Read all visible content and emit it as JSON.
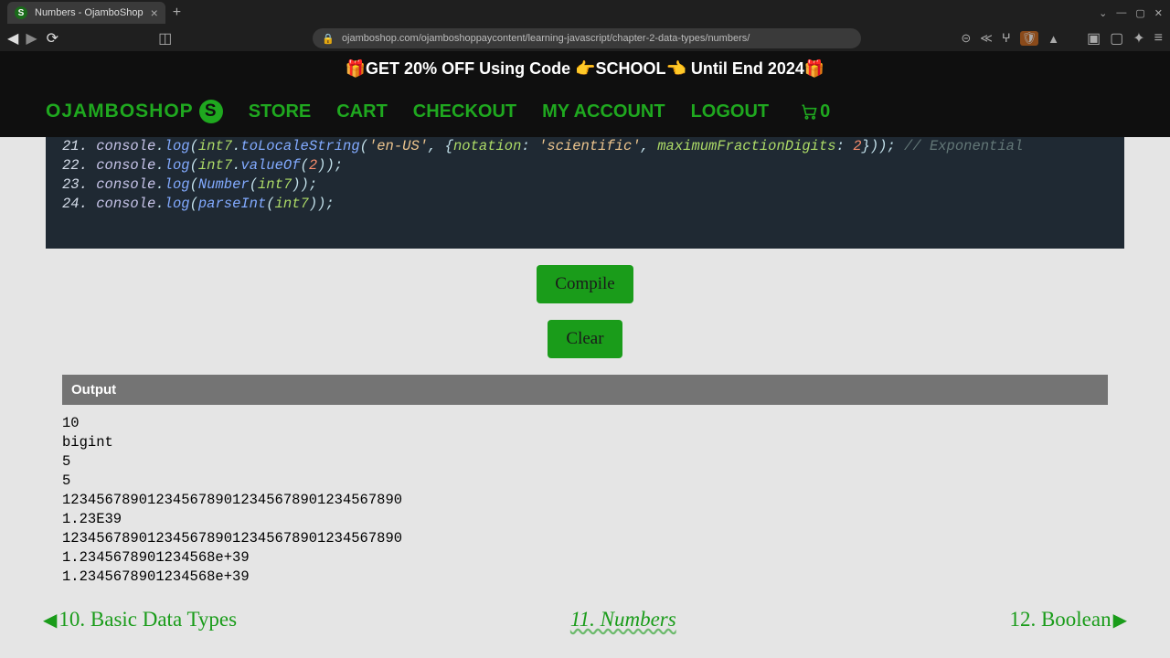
{
  "browser": {
    "tab_title": "Numbers - OjamboShop",
    "tab_favicon_letter": "S",
    "url": "ojamboshop.com/ojamboshoppaycontent/learning-javascript/chapter-2-data-types/numbers/"
  },
  "promo": "🎁GET 20% OFF Using Code 👉SCHOOL👈 Until End 2024🎁",
  "brand": {
    "name": "OJAMBOSHOP",
    "icon_letter": "S"
  },
  "nav": {
    "store": "STORE",
    "cart": "CART",
    "checkout": "CHECKOUT",
    "account": "MY ACCOUNT",
    "logout": "LOGOUT",
    "cart_count": "0"
  },
  "code_lines": [
    {
      "n": "21.",
      "segments": [
        {
          "c": "kw1",
          "t": "console"
        },
        {
          "c": "pn",
          "t": "."
        },
        {
          "c": "fn",
          "t": "log"
        },
        {
          "c": "pn",
          "t": "("
        },
        {
          "c": "var",
          "t": "int7"
        },
        {
          "c": "pn",
          "t": "."
        },
        {
          "c": "fn",
          "t": "toLocaleString"
        },
        {
          "c": "pn",
          "t": "("
        },
        {
          "c": "str",
          "t": "'en-US'"
        },
        {
          "c": "pn",
          "t": ", {"
        },
        {
          "c": "var",
          "t": "notation"
        },
        {
          "c": "pn",
          "t": ": "
        },
        {
          "c": "str",
          "t": "'scientific'"
        },
        {
          "c": "pn",
          "t": ", "
        },
        {
          "c": "var",
          "t": "maximumFractionDigits"
        },
        {
          "c": "pn",
          "t": ": "
        },
        {
          "c": "num",
          "t": "2"
        },
        {
          "c": "pn",
          "t": "}));"
        },
        {
          "c": "cm",
          "t": " // Exponential"
        }
      ]
    },
    {
      "n": "22.",
      "segments": [
        {
          "c": "kw1",
          "t": "console"
        },
        {
          "c": "pn",
          "t": "."
        },
        {
          "c": "fn",
          "t": "log"
        },
        {
          "c": "pn",
          "t": "("
        },
        {
          "c": "var",
          "t": "int7"
        },
        {
          "c": "pn",
          "t": "."
        },
        {
          "c": "fn",
          "t": "valueOf"
        },
        {
          "c": "pn",
          "t": "("
        },
        {
          "c": "num",
          "t": "2"
        },
        {
          "c": "pn",
          "t": "));"
        }
      ]
    },
    {
      "n": "23.",
      "segments": [
        {
          "c": "kw1",
          "t": "console"
        },
        {
          "c": "pn",
          "t": "."
        },
        {
          "c": "fn",
          "t": "log"
        },
        {
          "c": "pn",
          "t": "("
        },
        {
          "c": "fn",
          "t": "Number"
        },
        {
          "c": "pn",
          "t": "("
        },
        {
          "c": "var",
          "t": "int7"
        },
        {
          "c": "pn",
          "t": "));"
        }
      ]
    },
    {
      "n": "24.",
      "segments": [
        {
          "c": "kw1",
          "t": "console"
        },
        {
          "c": "pn",
          "t": "."
        },
        {
          "c": "fn",
          "t": "log"
        },
        {
          "c": "pn",
          "t": "("
        },
        {
          "c": "fn",
          "t": "parseInt"
        },
        {
          "c": "pn",
          "t": "("
        },
        {
          "c": "var",
          "t": "int7"
        },
        {
          "c": "pn",
          "t": "));"
        }
      ]
    }
  ],
  "buttons": {
    "compile": "Compile",
    "clear": "Clear"
  },
  "output": {
    "header": "Output",
    "lines": [
      "10",
      "bigint",
      "5",
      "5",
      "1234567890123456789012345678901234567890",
      "1.23E39",
      "1234567890123456789012345678901234567890",
      "1.2345678901234568e+39",
      "1.2345678901234568e+39"
    ]
  },
  "chapters": {
    "prev": "10. Basic Data Types",
    "current": "11. Numbers",
    "next": "12. Boolean"
  }
}
